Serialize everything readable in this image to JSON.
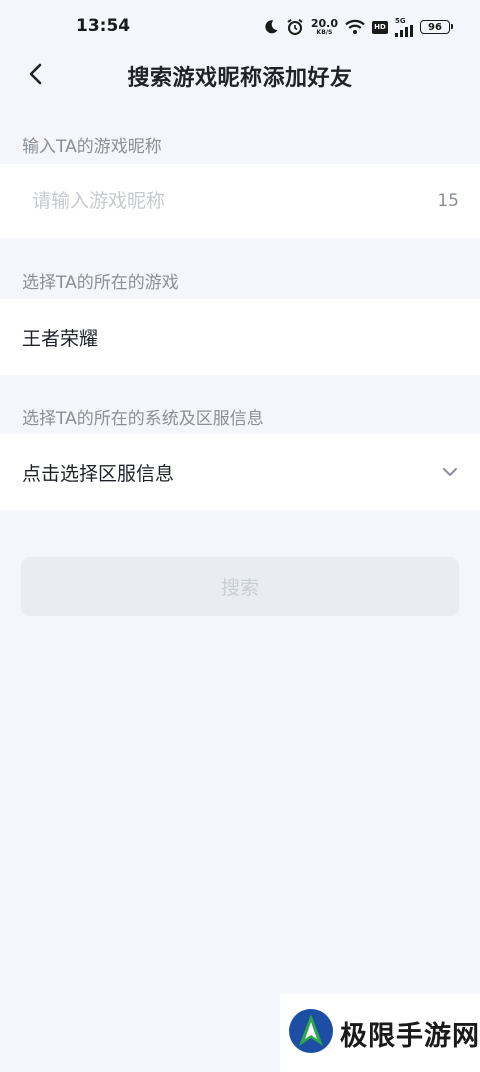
{
  "status_bar": {
    "time": "13:54",
    "net_speed": "20.0",
    "net_unit": "KB/S",
    "hd": "HD",
    "signal_label": "5G",
    "battery": "96"
  },
  "nav": {
    "title": "搜索游戏昵称添加好友"
  },
  "nickname_section": {
    "label": "输入TA的游戏昵称",
    "placeholder": "请输入游戏昵称",
    "value": "",
    "max_chars": "15"
  },
  "game_section": {
    "label": "选择TA的所在的游戏",
    "value": "王者荣耀"
  },
  "server_section": {
    "label": "选择TA的所在的系统及区服信息",
    "value": "点击选择区服信息"
  },
  "search_button": {
    "label": "搜索",
    "enabled": false
  },
  "watermark": {
    "text": "极限手游网"
  },
  "colors": {
    "background": "#f4f6fb",
    "card": "#ffffff",
    "label_gray": "#8a8f99",
    "placeholder": "#c7cad1",
    "button_disabled_bg": "#e9edf3",
    "button_disabled_text": "#c9cdd4"
  },
  "icons": {
    "back": "chevron-left-icon",
    "dropdown": "chevron-down-icon",
    "moon": "moon-icon",
    "alarm": "alarm-icon",
    "wifi": "wifi-icon",
    "signal": "signal-icon",
    "battery": "battery-icon"
  }
}
